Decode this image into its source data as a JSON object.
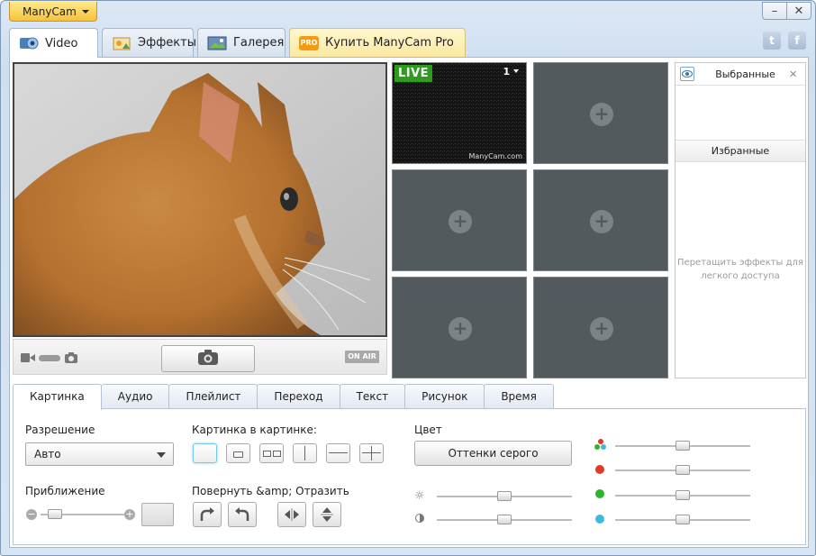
{
  "app": {
    "menu_label": "ManyCam"
  },
  "window": {
    "minimize": "–",
    "close": "✕"
  },
  "main_tabs": [
    {
      "label": "Video",
      "icon": "webcam-icon"
    },
    {
      "label": "Эффекты",
      "icon": "effects-icon"
    },
    {
      "label": "Галерея",
      "icon": "gallery-icon"
    },
    {
      "label": "Купить ManyCam Pro",
      "icon": "pro-badge-icon",
      "badge": "PRO"
    }
  ],
  "social": {
    "twitter": "t",
    "facebook": "f"
  },
  "preview": {
    "snapshot_icon": "camera-icon",
    "on_air": "ON AIR"
  },
  "grid": {
    "live_label": "LIVE",
    "live_number": "1",
    "watermark": "ManyCam.com"
  },
  "favorites": {
    "header": "Выбранные",
    "bar": "Избранные",
    "hint": "Перетащить эффекты для легкого доступа"
  },
  "sub_tabs": [
    "Картинка",
    "Аудио",
    "Плейлист",
    "Переход",
    "Текст",
    "Рисунок",
    "Время"
  ],
  "picture": {
    "resolution_label": "Разрешение",
    "resolution_value": "Авто",
    "zoom_label": "Приближение",
    "zoom_minus": "−",
    "zoom_plus": "+",
    "pip_label": "Картинка в картинке:",
    "rotate_label": "Повернуть &amp; Отразить",
    "color_label": "Цвет",
    "grayscale_button": "Оттенки серого"
  },
  "sliders": {
    "brightness": 0.5,
    "contrast": 0.5,
    "rgb": 0.5,
    "red": 0.5,
    "green": 0.5,
    "blue": 0.5,
    "zoom": 0.1
  },
  "colors": {
    "live": "#2e9a1e",
    "red": "#e03a2b",
    "green": "#2db52a",
    "blue": "#3dbbdf",
    "accent": "#f7c23a"
  }
}
